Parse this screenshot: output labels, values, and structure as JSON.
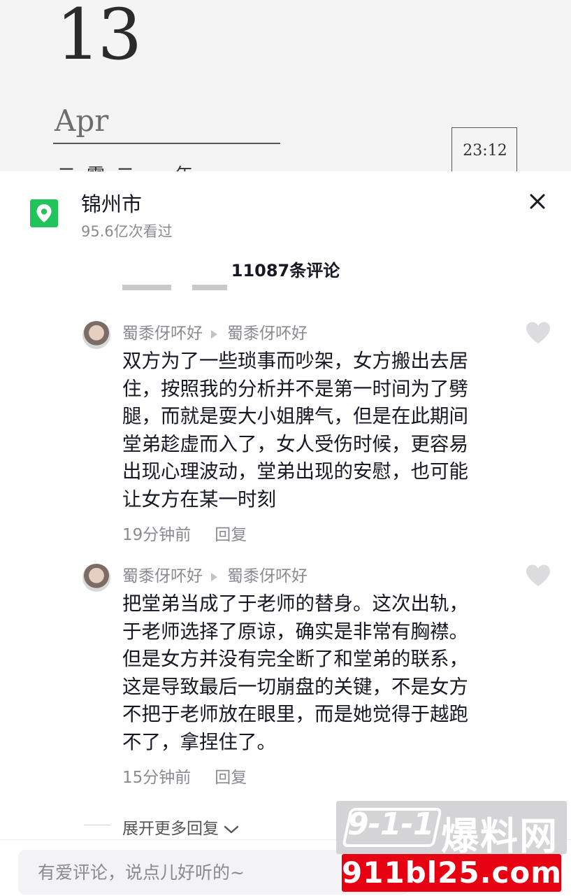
{
  "background": {
    "day": "13",
    "month": "Apr",
    "time": "23:12",
    "year_partial": "二零二一年"
  },
  "location": {
    "icon": "location-pin-icon",
    "title": "锦州市",
    "views": "95.6亿次看过"
  },
  "header": {
    "comment_count": "11087条评论",
    "close_icon": "close-icon"
  },
  "comments": [
    {
      "author": "蜀黍伢吥好",
      "reply_to": "蜀黍伢吥好",
      "lines": [
        "双方为了一些琐事而吵架，女方搬出去居",
        "住，按照我的分析并不是第一时间为了劈",
        "腿，而就是耍大小姐脾气，但是在此期间",
        "堂弟趁虚而入了，女人受伤时候，更容易",
        "出现心理波动，堂弟出现的安慰，也可能",
        "让女方在某一时刻"
      ],
      "time": "19分钟前",
      "reply_label": "回复"
    },
    {
      "author": "蜀黍伢吥好",
      "reply_to": "蜀黍伢吥好",
      "lines": [
        "把堂弟当成了于老师的替身。这次出轨，",
        "于老师选择了原谅，确实是非常有胸襟。",
        "但是女方并没有完全断了和堂弟的联系，",
        "这是导致最后一切崩盘的关键，不是女方",
        "不把于老师放在眼里，而是她觉得于越跑",
        "不了，拿捏住了。"
      ],
      "time": "15分钟前",
      "reply_label": "回复"
    }
  ],
  "expand": {
    "label": "展开更多回复"
  },
  "input": {
    "placeholder": "有爱评论，说点儿好听的~"
  },
  "watermark": {
    "logo": "9-1-1",
    "name": "爆料网",
    "url": "911bl25.com"
  },
  "colors": {
    "location_green": "#22c35a",
    "watermark_red": "#e60012",
    "secondary_text": "#8a8b91"
  }
}
